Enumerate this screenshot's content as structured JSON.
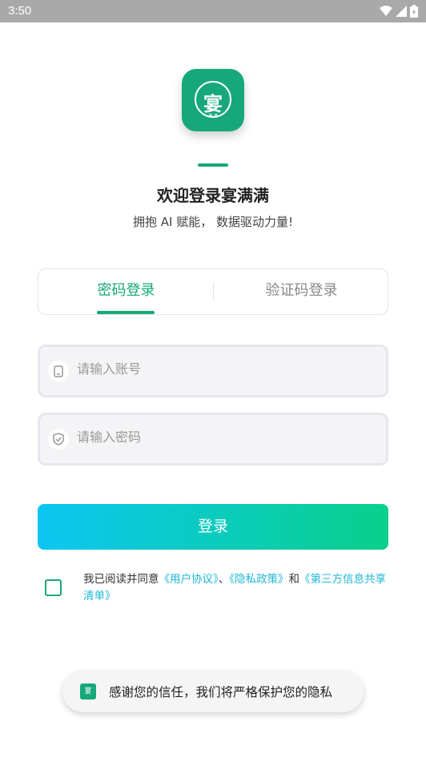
{
  "status_bar": {
    "time": "3:50"
  },
  "logo": {
    "char": "宴",
    "sub": "满 满"
  },
  "welcome": {
    "title": "欢迎登录宴满满",
    "subtitle": "拥抱 AI 赋能， 数据驱动力量!"
  },
  "tabs": [
    {
      "label": "密码登录",
      "active": true
    },
    {
      "label": "验证码登录",
      "active": false
    }
  ],
  "account_input": {
    "placeholder": "请输入账号",
    "value": "",
    "icon": "phone-icon"
  },
  "password_input": {
    "placeholder": "请输入密码",
    "value": "",
    "icon": "shield-check-icon"
  },
  "login_button": {
    "label": "登录"
  },
  "agreement": {
    "prefix": "我已阅读并同意",
    "user_agreement": "《用户协议》",
    "separator": "、",
    "privacy_policy": "《隐私政策》",
    "and": "和",
    "third_party": "《第三方信息共享清单》",
    "checked": false
  },
  "toast": {
    "text": "感谢您的信任，我们将严格保护您的隐私"
  },
  "colors": {
    "brand_green": "#16a87a",
    "gradient_start": "#0dc6f2",
    "gradient_end": "#09d08a",
    "link": "#1fb6d6"
  }
}
